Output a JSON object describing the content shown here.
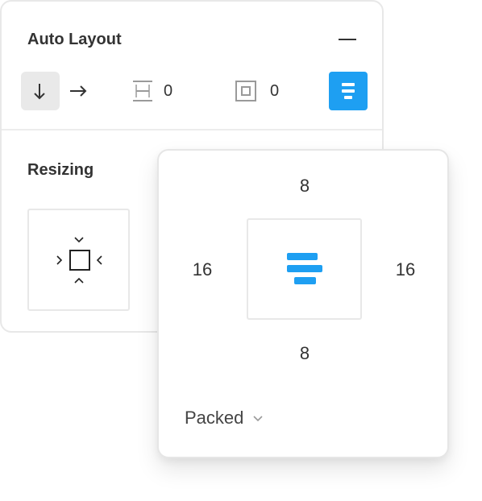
{
  "panel": {
    "title": "Auto Layout",
    "direction_options": [
      "vertical",
      "horizontal"
    ],
    "selected_direction": "vertical",
    "spacing_value": "0",
    "padding_value": "0",
    "accent_color": "#1e9ff2"
  },
  "resizing": {
    "title": "Resizing"
  },
  "popover": {
    "padding_top": "8",
    "padding_left": "16",
    "padding_right": "16",
    "padding_bottom": "8",
    "mode": "Packed"
  },
  "icons": [
    "minus-icon",
    "arrow-down-icon",
    "arrow-right-icon",
    "item-spacing-icon",
    "padding-icon",
    "align-center-icon",
    "resize-hug-icon",
    "chevron-down-icon"
  ]
}
